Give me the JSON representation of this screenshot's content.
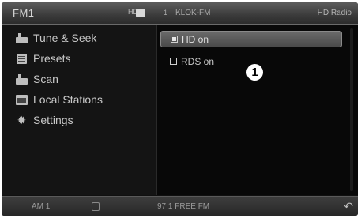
{
  "status_bar": {
    "band": "FM1",
    "hd_signal": "HD",
    "preset_number": "1",
    "station": "KLOK-FM",
    "top_right": "HD Radio"
  },
  "menu": {
    "items": [
      {
        "label": "Tune & Seek",
        "icon": "tune-icon"
      },
      {
        "label": "Presets",
        "icon": "presets-icon"
      },
      {
        "label": "Scan",
        "icon": "scan-icon"
      },
      {
        "label": "Local Stations",
        "icon": "local-stations-icon"
      },
      {
        "label": "Settings",
        "icon": "gear-icon"
      }
    ]
  },
  "options": {
    "hd": {
      "label": "HD on",
      "checked": true
    },
    "rds": {
      "label": "RDS on",
      "checked": false
    }
  },
  "callout": "1",
  "bottom_bar": {
    "left_text": "AM 1",
    "frequency": "97.1 FREE FM",
    "back": "↶"
  },
  "colors": {
    "screen_bg": "#101010",
    "highlight": "#5a5a5a",
    "text": "#c8c8c8"
  }
}
